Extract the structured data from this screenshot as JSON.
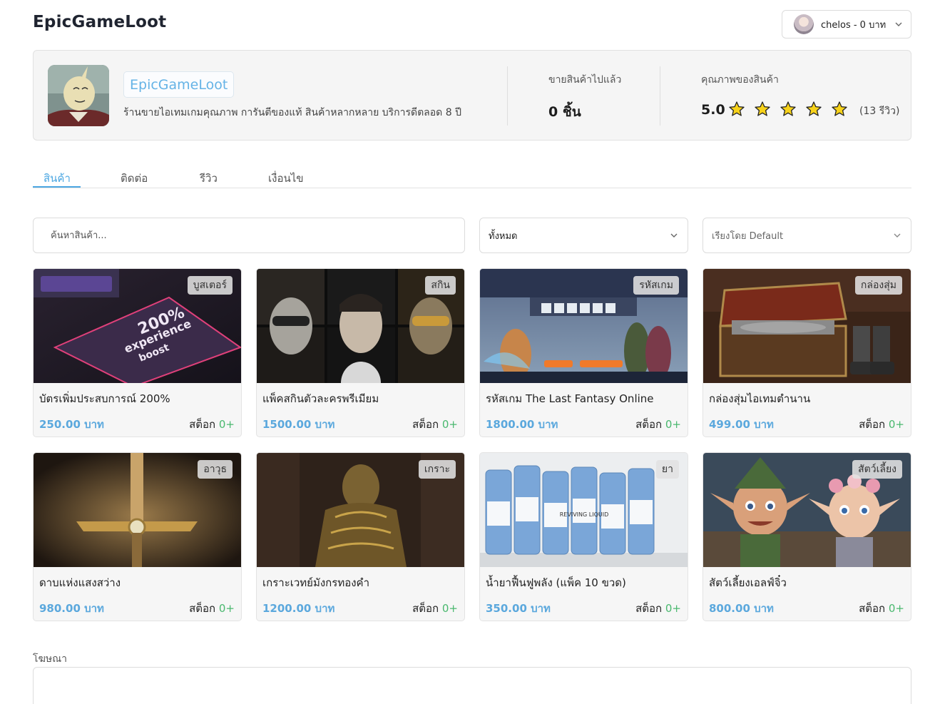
{
  "site": {
    "title": "EpicGameLoot"
  },
  "user": {
    "label": "chelos - 0 บาท"
  },
  "shop": {
    "name": "EpicGameLoot",
    "description": "ร้านขายไอเทมเกมคุณภาพ การันตีของแท้ สินค้าหลากหลาย บริการดีตลอด 8 ปี",
    "sold_label": "ขายสินค้าไปแล้ว",
    "sold_value": "0 ชิ้น",
    "quality_label": "คุณภาพของสินค้า",
    "rating": "5.0",
    "rating_stars": 5,
    "review_count": "(13 รีวิว)"
  },
  "tabs": [
    {
      "label": "สินค้า",
      "active": true
    },
    {
      "label": "ติดต่อ",
      "active": false
    },
    {
      "label": "รีวิว",
      "active": false
    },
    {
      "label": "เงื่อนไข",
      "active": false
    }
  ],
  "filters": {
    "search_placeholder": "ค้นหาสินค้า...",
    "category_value": "ทั้งหมด",
    "sort_value": "เรียงโดย Default"
  },
  "stock_label": "สต็อก",
  "products": [
    {
      "name": "บัตรเพิ่มประสบการณ์ 200%",
      "price": "250.00 บาท",
      "category": "บูสเตอร์",
      "stock": "0+"
    },
    {
      "name": "แพ็คสกินตัวละครพรีเมียม",
      "price": "1500.00 บาท",
      "category": "สกิน",
      "stock": "0+"
    },
    {
      "name": "รหัสเกม The Last Fantasy Online",
      "price": "1800.00 บาท",
      "category": "รหัสเกม",
      "stock": "0+"
    },
    {
      "name": "กล่องสุ่มไอเทมตำนาน",
      "price": "499.00 บาท",
      "category": "กล่องสุ่ม",
      "stock": "0+"
    },
    {
      "name": "ดาบแห่งแสงสว่าง",
      "price": "980.00 บาท",
      "category": "อาวุธ",
      "stock": "0+"
    },
    {
      "name": "เกราะเวทย์มังกรทองคำ",
      "price": "1200.00 บาท",
      "category": "เกราะ",
      "stock": "0+"
    },
    {
      "name": "น้ำยาฟื้นฟูพลัง (แพ็ค 10 ขวด)",
      "price": "350.00 บาท",
      "category": "ยา",
      "stock": "0+"
    },
    {
      "name": "สัตว์เลี้ยงเอลฟ์จิ๋ว",
      "price": "800.00 บาท",
      "category": "สัตว์เลี้ยง",
      "stock": "0+"
    }
  ],
  "image_text": {
    "boost_line1": "200%",
    "boost_line2": "experience",
    "boost_line3": "boost",
    "bottle_label": "REVIVING LIQUID"
  },
  "ads": {
    "label": "โฆษณา"
  },
  "colors": {
    "accent": "#4ca7e2",
    "price": "#5ba8dd",
    "stock_count": "#49b86e",
    "star": "#f7d21a"
  }
}
